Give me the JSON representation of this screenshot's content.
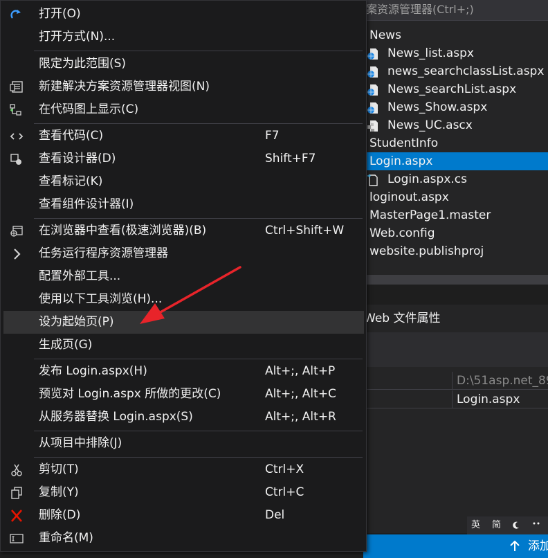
{
  "solution_explorer": {
    "search_placeholder": "案资源管理器(Ctrl+;)",
    "items": [
      {
        "label": "News",
        "icon": "folder-icon"
      },
      {
        "label": "News_list.aspx",
        "icon": "web-page-icon"
      },
      {
        "label": "news_searchclassList.aspx",
        "icon": "web-page-icon"
      },
      {
        "label": "News_searchList.aspx",
        "icon": "web-page-icon"
      },
      {
        "label": "News_Show.aspx",
        "icon": "web-page-icon"
      },
      {
        "label": "News_UC.ascx",
        "icon": "user-control-icon"
      },
      {
        "label": "StudentInfo",
        "icon": "folder-icon"
      },
      {
        "label": "Login.aspx",
        "icon": "web-page-icon",
        "selected": true
      },
      {
        "label": "Login.aspx.cs",
        "icon": "cs-file-icon"
      },
      {
        "label": "loginout.aspx",
        "icon": "web-page-icon"
      },
      {
        "label": "MasterPage1.master",
        "icon": "master-page-icon"
      },
      {
        "label": "Web.config",
        "icon": "config-file-icon"
      },
      {
        "label": "website.publishproj",
        "icon": "project-file-icon"
      }
    ]
  },
  "properties": {
    "header": "Web 文件属性",
    "rows": [
      {
        "value": "D:\\51asp.net_89",
        "muted": true
      },
      {
        "value": "Login.aspx",
        "muted": false
      }
    ]
  },
  "ime": {
    "lang": "英",
    "mode": "简",
    "icon1": "moon-icon",
    "icon2": "punctuation-icon"
  },
  "status_bar": {
    "publish_label": "添加"
  },
  "context_menu": {
    "items": [
      {
        "label": "打开(O)",
        "shortcut": "",
        "icon": "redo-arrow-icon"
      },
      {
        "label": "打开方式(N)...",
        "shortcut": "",
        "icon": ""
      },
      {
        "label": "限定为此范围(S)",
        "shortcut": "",
        "icon": ""
      },
      {
        "label": "新建解决方案资源管理器视图(N)",
        "shortcut": "",
        "icon": "new-window-icon"
      },
      {
        "label": "在代码图上显示(C)",
        "shortcut": "",
        "icon": "code-map-icon"
      },
      {
        "label": "查看代码(C)",
        "shortcut": "F7",
        "icon": "code-brackets-icon"
      },
      {
        "label": "查看设计器(D)",
        "shortcut": "Shift+F7",
        "icon": "designer-icon"
      },
      {
        "label": "查看标记(K)",
        "shortcut": "",
        "icon": ""
      },
      {
        "label": "查看组件设计器(I)",
        "shortcut": "",
        "icon": ""
      },
      {
        "label": "在浏览器中查看(极速浏览器)(B)",
        "shortcut": "Ctrl+Shift+W",
        "icon": "browser-icon"
      },
      {
        "label": "任务运行程序资源管理器",
        "shortcut": "",
        "icon": "chevron-right-icon"
      },
      {
        "label": "配置外部工具...",
        "shortcut": "",
        "icon": ""
      },
      {
        "label": "使用以下工具浏览(H)...",
        "shortcut": "",
        "icon": ""
      },
      {
        "label": "设为起始页(P)",
        "shortcut": "",
        "icon": "",
        "highlight": true
      },
      {
        "label": "生成页(G)",
        "shortcut": "",
        "icon": ""
      },
      {
        "label": "发布 Login.aspx(H)",
        "shortcut": "Alt+;, Alt+P",
        "icon": ""
      },
      {
        "label": "预览对 Login.aspx 所做的更改(C)",
        "shortcut": "Alt+;, Alt+C",
        "icon": ""
      },
      {
        "label": "从服务器替换 Login.aspx(S)",
        "shortcut": "Alt+;, Alt+R",
        "icon": ""
      },
      {
        "label": "从项目中排除(J)",
        "shortcut": "",
        "icon": ""
      },
      {
        "label": "剪切(T)",
        "shortcut": "Ctrl+X",
        "icon": "scissors-icon"
      },
      {
        "label": "复制(Y)",
        "shortcut": "Ctrl+C",
        "icon": "copy-icon"
      },
      {
        "label": "删除(D)",
        "shortcut": "Del",
        "icon": "delete-x-icon"
      },
      {
        "label": "重命名(M)",
        "shortcut": "",
        "icon": "rename-icon"
      }
    ]
  },
  "colors": {
    "menu_bg": "#1b1b1c",
    "highlight": "#333334",
    "selection": "#007acc",
    "arrow": "#e8242a",
    "delete_icon": "#e51400"
  }
}
